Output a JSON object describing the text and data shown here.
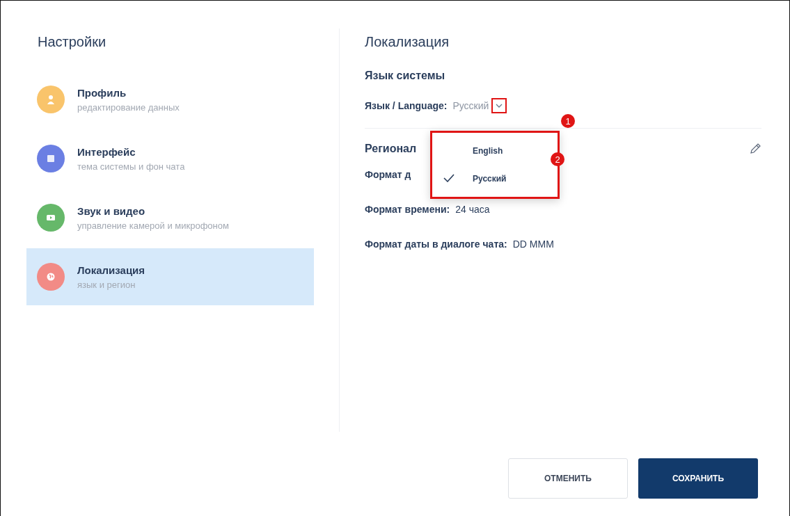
{
  "sidebar": {
    "title": "Настройки",
    "items": [
      {
        "title": "Профиль",
        "subtitle": "редактирование данных",
        "color": "#f9c46b",
        "kind": "person",
        "selected": false
      },
      {
        "title": "Интерфейс",
        "subtitle": "тема системы и фон чата",
        "color": "#6b7fe3",
        "kind": "palette",
        "selected": false
      },
      {
        "title": "Звук и видео",
        "subtitle": "управление камерой и микрофоном",
        "color": "#66b86a",
        "kind": "video",
        "selected": false
      },
      {
        "title": "Локализация",
        "subtitle": "язык и регион",
        "color": "#f28b86",
        "kind": "globe",
        "selected": true
      }
    ]
  },
  "content": {
    "title": "Локализация",
    "language_section": {
      "heading": "Язык системы",
      "label": "Язык / Language:",
      "value": "Русский",
      "expanded": true
    },
    "region_section": {
      "heading": "Регионал",
      "rows": [
        {
          "label": "Формат д",
          "value": ""
        },
        {
          "label": "Формат времени:",
          "value": "24 часа"
        },
        {
          "label": "Формат даты в диалоге чата:",
          "value": "DD MMM"
        }
      ]
    },
    "dropdown": {
      "options": [
        {
          "label": "English",
          "selected": false
        },
        {
          "label": "Русский",
          "selected": true
        }
      ]
    }
  },
  "annotations": [
    "1",
    "2"
  ],
  "buttons": {
    "cancel": "ОТМЕНИТЬ",
    "save": "СОХРАНИТЬ"
  }
}
